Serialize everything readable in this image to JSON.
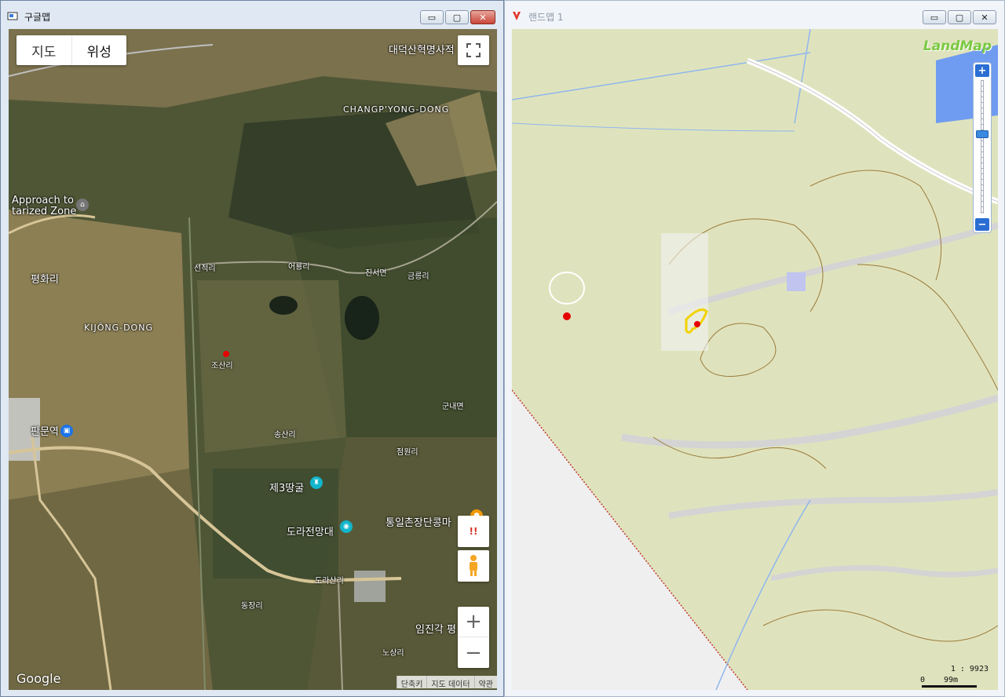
{
  "google_window": {
    "title": "구글맵",
    "controls": {
      "minimize": "▭",
      "maximize": "▢",
      "close": "✕"
    },
    "map_type": {
      "map": "지도",
      "satellite": "위성"
    },
    "labels": {
      "daedeok": "대덕산혁명사적",
      "changpyong": "CHANGP'YONG-DONG",
      "approach": "Approach to\ntarized Zone",
      "pyeonghwa": "평화리",
      "kijong": "KIJŎNG-DONG",
      "seonjeok": "선적리",
      "eoryong": "어룡리",
      "jinseo": "진서면",
      "geumreung": "금릉리",
      "josan": "조산리",
      "panmun": "판문역",
      "gunnae": "군내면",
      "songsan": "송산리",
      "jeomwon": "점원리",
      "tunnel3": "제3땅굴",
      "dora_obs": "도라전망대",
      "tongil": "통일촌장단콩마",
      "dorasan": "도라산리",
      "dongjang": "동장리",
      "imjingak": "임진각 평",
      "nosang": "노상리"
    },
    "google_logo": "Google",
    "attribution": [
      "단축키",
      "지도 데이터",
      "약관"
    ],
    "buttons": {
      "zoom_in": "+",
      "zoom_out": "−",
      "alert": "!!"
    }
  },
  "land_window": {
    "title": "랜드맵 1",
    "logo": "LandMap",
    "zoom": {
      "in": "+",
      "out": "−"
    },
    "scale_ratio": "1 : 9923",
    "scale_start": "0",
    "scale_end": "99m"
  },
  "colors": {
    "satellite_base": "#4a5234",
    "landmap_base": "#dfe3bd",
    "marker_red": "#e60000",
    "landmap_logo": "#7ac943"
  }
}
